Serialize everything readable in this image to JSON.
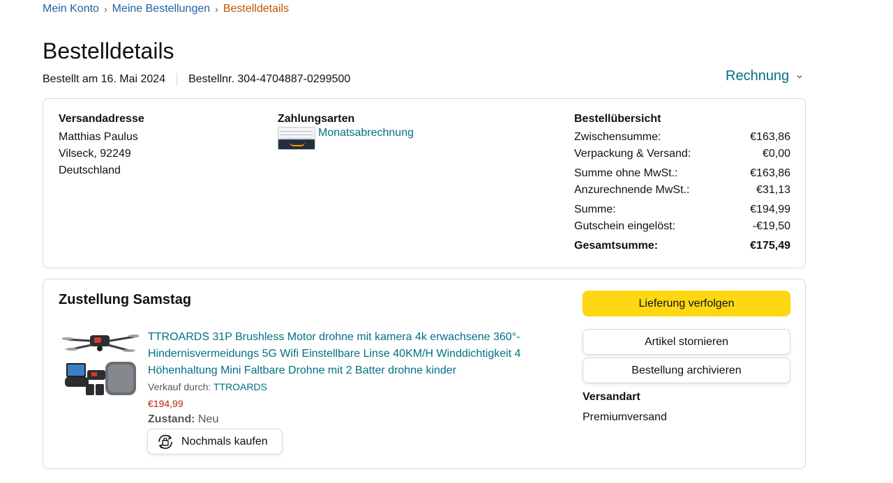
{
  "breadcrumb": {
    "items": [
      {
        "label": "Mein Konto"
      },
      {
        "label": "Meine Bestellungen"
      }
    ],
    "separator": "›",
    "current": "Bestelldetails"
  },
  "page_title": "Bestelldetails",
  "order_meta": {
    "date": "Bestellt am 16. Mai 2024",
    "number": "Bestellnr. 304-4704887-0299500"
  },
  "invoice_label": "Rechnung",
  "shipping_address": {
    "heading": "Versandadresse",
    "name": "Matthias Paulus",
    "city": "Vilseck, 92249",
    "country": "Deutschland"
  },
  "payment": {
    "heading": "Zahlungsarten",
    "method": "Monatsabrechnung"
  },
  "order_summary": {
    "heading": "Bestellübersicht",
    "rows": [
      {
        "label": "Zwischensumme:",
        "value": "€163,86"
      },
      {
        "label": "Verpackung & Versand:",
        "value": "€0,00"
      },
      {
        "label": "Summe ohne MwSt.:",
        "value": "€163,86"
      },
      {
        "label": "Anzurechnende MwSt.:",
        "value": "€31,13"
      },
      {
        "label": "Summe:",
        "value": "€194,99"
      },
      {
        "label": "Gutschein eingelöst:",
        "value": "-€19,50"
      }
    ],
    "total": {
      "label": "Gesamtsumme:",
      "value": "€175,49"
    }
  },
  "delivery": {
    "heading": "Zustellung Samstag",
    "product": {
      "title": "TTROARDS 31P Brushless Motor drohne mit kamera 4k erwachsene 360°-Hindernisvermeidungs 5G Wifi Einstellbare Linse 40KM/H Winddichtigkeit 4 Höhenhaltung Mini Faltbare Drohne mit 2 Batter drohne kinder",
      "seller_prefix": "Verkauf durch:",
      "seller": "TTROARDS",
      "price": "€194,99",
      "condition_label": "Zustand:",
      "condition": "Neu",
      "buy_again": "Nochmals kaufen"
    },
    "buttons": {
      "track": "Lieferung verfolgen",
      "cancel": "Artikel stornieren",
      "archive": "Bestellung archivieren"
    },
    "shipping_type_label": "Versandart",
    "shipping_type": "Premiumversand"
  },
  "colors": {
    "link": "#007185",
    "breadcrumb_link": "#2162a1",
    "breadcrumb_current": "#c45500",
    "price": "#b12704",
    "primary_button": "#ffd814",
    "border": "#d5d9d9"
  }
}
